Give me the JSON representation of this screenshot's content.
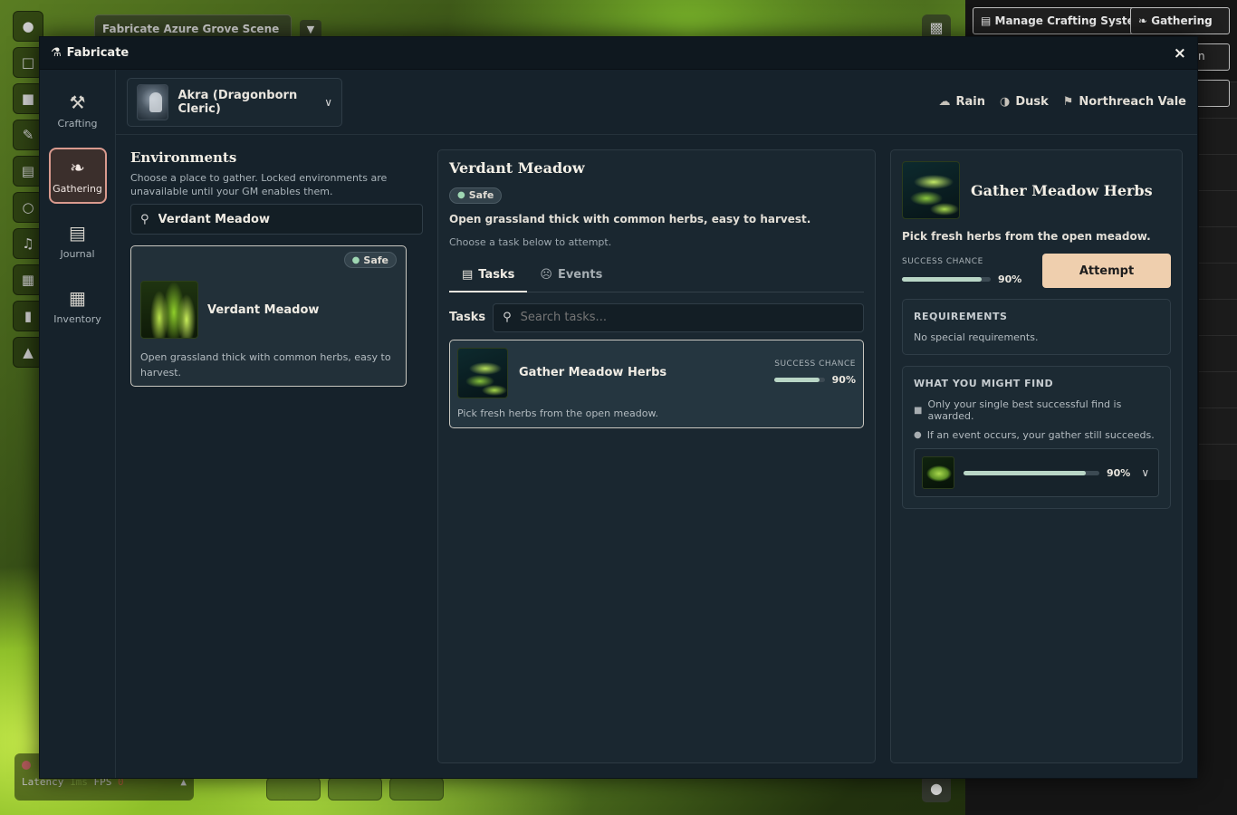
{
  "background": {
    "scene_tab": "Fabricate Azure Grove Scene",
    "top_buttons": {
      "manage": "Manage Crafting Systems",
      "gathering": "Gathering"
    },
    "side_button_text": "n",
    "perf": {
      "latency_label": "Latency",
      "latency_value": "1ms",
      "fps_label": "FPS",
      "fps_value": "0"
    }
  },
  "window": {
    "title": "Fabricate",
    "close_icon": "×"
  },
  "sidebar": {
    "items": [
      {
        "label": "Crafting",
        "icon": "hammer-icon"
      },
      {
        "label": "Gathering",
        "icon": "leaf-icon",
        "active": true
      },
      {
        "label": "Journal",
        "icon": "book-icon"
      },
      {
        "label": "Inventory",
        "icon": "boxes-icon"
      }
    ]
  },
  "header": {
    "character": "Akra (Dragonborn Cleric)",
    "conditions": [
      {
        "label": "Rain",
        "icon": "cloud-rain-icon"
      },
      {
        "label": "Dusk",
        "icon": "moon-icon"
      },
      {
        "label": "Northreach Vale",
        "icon": "map-icon"
      }
    ]
  },
  "environments": {
    "title": "Environments",
    "description": "Choose a place to gather. Locked environments are unavailable until your GM enables them.",
    "search_value": "Verdant Meadow",
    "cards": [
      {
        "name": "Verdant Meadow",
        "badge": "Safe",
        "description": "Open grassland thick with common herbs, easy to harvest."
      }
    ]
  },
  "environment_detail": {
    "title": "Verdant Meadow",
    "badge": "Safe",
    "description": "Open grassland thick with common herbs, easy to harvest.",
    "hint": "Choose a task below to attempt.",
    "tabs": [
      {
        "label": "Tasks",
        "active": true
      },
      {
        "label": "Events"
      }
    ],
    "task_search_label": "Tasks",
    "task_search_placeholder": "Search tasks...",
    "tasks": [
      {
        "name": "Gather Meadow Herbs",
        "chance_label": "SUCCESS CHANCE",
        "chance_text": "90%",
        "chance": 0.9,
        "description": "Pick fresh herbs from the open meadow."
      }
    ]
  },
  "task_detail": {
    "title": "Gather Meadow Herbs",
    "description": "Pick fresh herbs from the open meadow.",
    "chance_label": "SUCCESS CHANCE",
    "chance_text": "90%",
    "chance": 0.9,
    "attempt_label": "Attempt",
    "requirements": {
      "title": "REQUIREMENTS",
      "text": "No special requirements."
    },
    "finds": {
      "title": "WHAT YOU MIGHT FIND",
      "notes": [
        "Only your single best successful find is awarded.",
        "If an event occurs, your gather still succeeds."
      ],
      "items": [
        {
          "chance_text": "90%",
          "chance": 0.9
        }
      ]
    }
  }
}
